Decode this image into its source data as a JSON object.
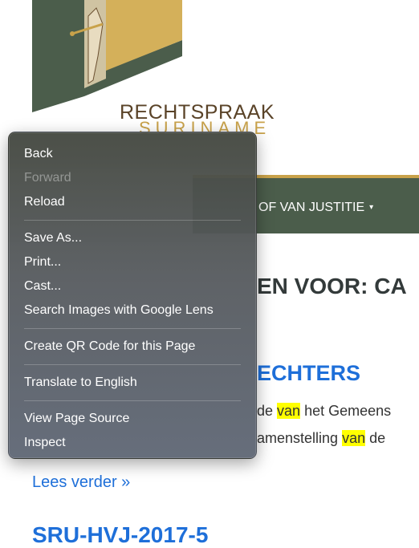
{
  "logo": {
    "brand": "RECHTSPRAAK",
    "subtitle": "SURINAME",
    "colors": {
      "green": "#4b5d4b",
      "gold": "#c9a24a",
      "brown": "#5a4328"
    }
  },
  "nav": {
    "item_label": "OF VAN JUSTITIE",
    "caret": "▾"
  },
  "page": {
    "heading": "EN VOOR: CA",
    "result_title": "ECHTERS",
    "snippet1_pre": "de ",
    "snippet1_hl": "van",
    "snippet1_post": " het Gemeens",
    "snippet2_pre": "amenstelling ",
    "snippet2_hl": "van",
    "snippet2_post": " de",
    "read_more": "Lees verder »",
    "next_title": "SRU-HVJ-2017-5"
  },
  "context_menu": {
    "back": "Back",
    "forward": "Forward",
    "reload": "Reload",
    "save_as": "Save As...",
    "print": "Print...",
    "cast": "Cast...",
    "search_images": "Search Images with Google Lens",
    "qr_code": "Create QR Code for this Page",
    "translate": "Translate to English",
    "view_source": "View Page Source",
    "inspect": "Inspect"
  }
}
